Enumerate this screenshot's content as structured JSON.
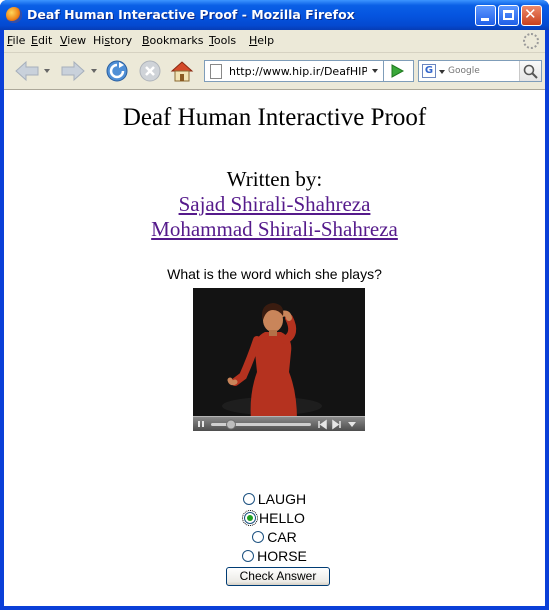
{
  "window": {
    "title": "Deaf Human Interactive Proof - Mozilla Firefox"
  },
  "menubar": {
    "items": [
      {
        "label": "File",
        "accel": "F"
      },
      {
        "label": "Edit",
        "accel": "E"
      },
      {
        "label": "View",
        "accel": "V"
      },
      {
        "label": "History",
        "accel": "s"
      },
      {
        "label": "Bookmarks",
        "accel": "B"
      },
      {
        "label": "Tools",
        "accel": "T"
      },
      {
        "label": "Help",
        "accel": "H"
      }
    ]
  },
  "toolbar": {
    "url": "http://www.hip.ir/DeafHIP/",
    "search_placeholder": "Google",
    "search_engine_letter": "G",
    "icons": [
      "back-icon",
      "forward-icon",
      "reload-icon",
      "stop-icon",
      "home-icon",
      "go-icon",
      "search-icon"
    ]
  },
  "page": {
    "heading": "Deaf Human Interactive Proof",
    "written_by": "Written by:",
    "authors": [
      "Sajad Shirali-Shahreza",
      "Mohammad Shirali-Shahreza"
    ],
    "question": "What is the word which she plays?",
    "options": [
      {
        "label": "LAUGH",
        "selected": false
      },
      {
        "label": "HELLO",
        "selected": true
      },
      {
        "label": "CAR",
        "selected": false
      },
      {
        "label": "HORSE",
        "selected": false
      }
    ],
    "submit_label": "Check Answer"
  },
  "video": {
    "playing": false,
    "progress": 0.2
  },
  "colors": {
    "titlebar": "#0555e0",
    "link_visited": "#551a8b",
    "chrome": "#ece9d8",
    "player_bg": "#131313"
  }
}
